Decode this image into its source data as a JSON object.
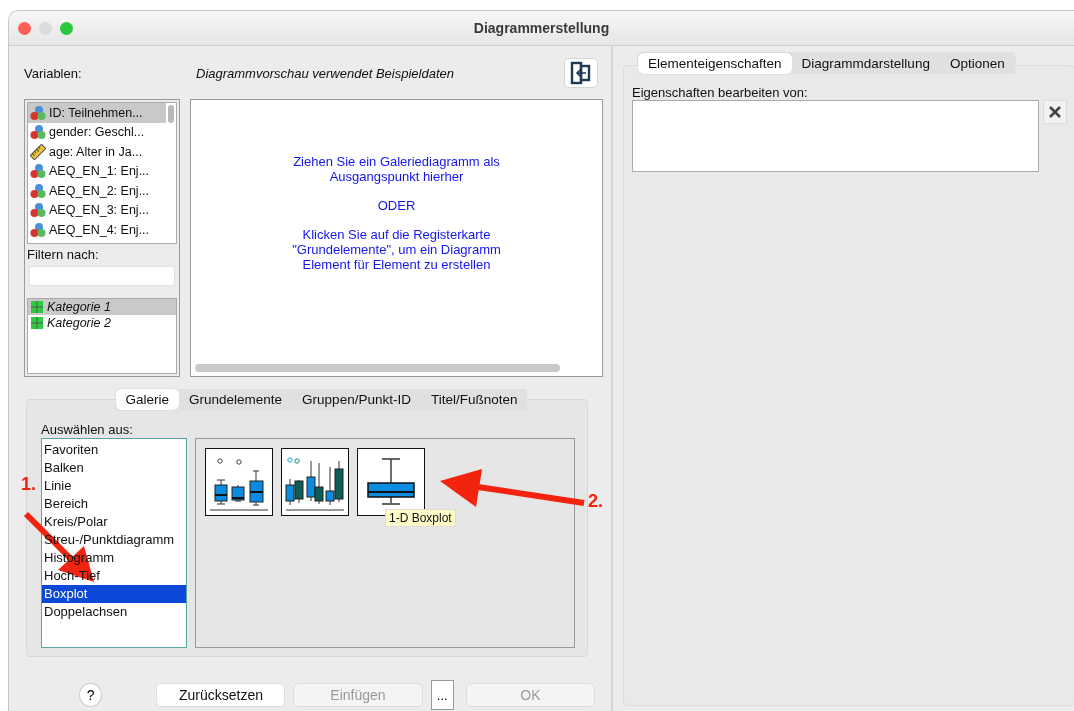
{
  "window": {
    "title": "Diagrammerstellung"
  },
  "header": {
    "variables_label": "Variablen:",
    "preview_note": "Diagrammvorschau verwendet Beispieldaten"
  },
  "variables": [
    {
      "label": "ID: Teilnehmen...",
      "kind": "nominal",
      "selected": true
    },
    {
      "label": "gender: Geschl...",
      "kind": "nominal",
      "selected": false
    },
    {
      "label": "age: Alter in Ja...",
      "kind": "scale",
      "selected": false
    },
    {
      "label": "AEQ_EN_1: Enj...",
      "kind": "nominal",
      "selected": false
    },
    {
      "label": "AEQ_EN_2: Enj...",
      "kind": "nominal",
      "selected": false
    },
    {
      "label": "AEQ_EN_3: Enj...",
      "kind": "nominal",
      "selected": false
    },
    {
      "label": "AEQ_EN_4: Enj...",
      "kind": "nominal",
      "selected": false
    }
  ],
  "filter": {
    "label": "Filtern nach:"
  },
  "categories": [
    {
      "label": "Kategorie 1",
      "selected": true
    },
    {
      "label": "Kategorie 2",
      "selected": false
    }
  ],
  "preview": {
    "paragraphs": [
      [
        "Ziehen Sie ein Galeriediagramm als",
        "Ausgangspunkt hierher"
      ],
      [
        "ODER"
      ],
      [
        "Klicken Sie auf die Registerkarte",
        "\"Grundelemente\", um ein Diagramm",
        "Element für Element zu erstellen"
      ]
    ]
  },
  "tabs": [
    {
      "label": "Galerie",
      "selected": true
    },
    {
      "label": "Grundelemente",
      "selected": false
    },
    {
      "label": "Gruppen/Punkt-ID",
      "selected": false
    },
    {
      "label": "Titel/Fußnoten",
      "selected": false
    }
  ],
  "gallery": {
    "label": "Auswählen aus:",
    "types": [
      {
        "label": "Favoriten",
        "selected": false
      },
      {
        "label": "Balken",
        "selected": false
      },
      {
        "label": "Linie",
        "selected": false
      },
      {
        "label": "Bereich",
        "selected": false
      },
      {
        "label": "Kreis/Polar",
        "selected": false
      },
      {
        "label": "Streu-/Punktdiagramm",
        "selected": false
      },
      {
        "label": "Histogramm",
        "selected": false
      },
      {
        "label": "Hoch-Tief",
        "selected": false
      },
      {
        "label": "Boxplot",
        "selected": true
      },
      {
        "label": "Doppelachsen",
        "selected": false
      }
    ],
    "thumbnails": [
      {
        "kind": "simple"
      },
      {
        "kind": "clustered"
      },
      {
        "kind": "one-d"
      }
    ],
    "tooltip": "1-D Boxplot"
  },
  "buttons": [
    {
      "label": "?",
      "kind": "help",
      "disabled": false
    },
    {
      "label": "Zurücksetzen",
      "kind": "push",
      "disabled": false
    },
    {
      "label": "Einfügen",
      "kind": "push",
      "disabled": true
    },
    {
      "label": "...",
      "kind": "small",
      "disabled": false
    },
    {
      "label": "OK",
      "kind": "push",
      "disabled": true
    }
  ],
  "annotations": [
    {
      "label": "1."
    },
    {
      "label": "2."
    }
  ],
  "properties": {
    "tabs": [
      {
        "label": "Elementeigenschaften",
        "selected": true
      },
      {
        "label": "Diagrammdarstellung",
        "selected": false
      },
      {
        "label": "Optionen",
        "selected": false
      }
    ],
    "label": "Eigenschaften bearbeiten von:"
  }
}
